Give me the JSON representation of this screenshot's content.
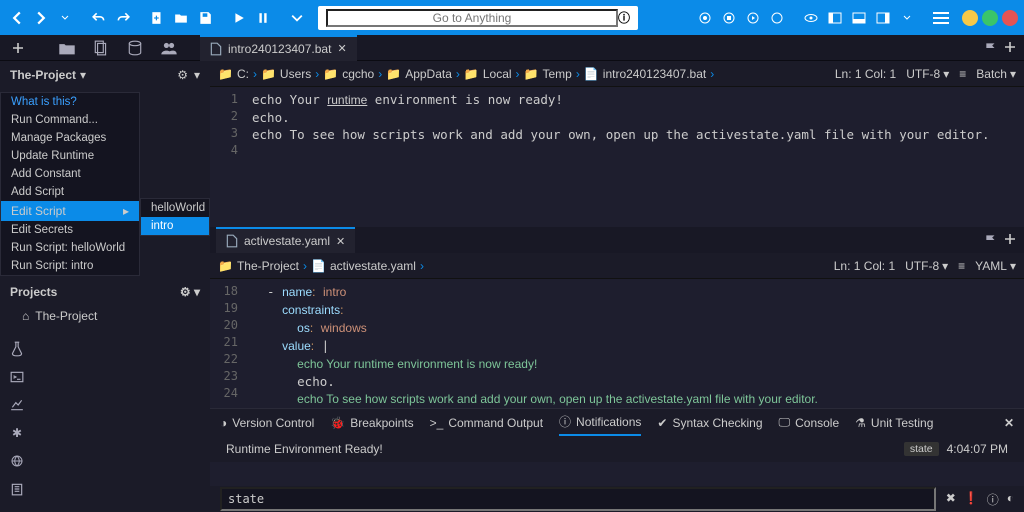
{
  "search": {
    "placeholder": "Go to Anything"
  },
  "sidebar": {
    "project_dropdown": "The-Project",
    "projects_label": "Projects",
    "project_item": "The-Project"
  },
  "context_menu": {
    "items": [
      "What is this?",
      "Run Command...",
      "Manage Packages",
      "Update Runtime",
      "Add Constant",
      "Add Script",
      "Edit Script",
      "Edit Secrets",
      "Run Script: helloWorld",
      "Run Script: intro"
    ],
    "submenu": [
      "helloWorld",
      "intro"
    ]
  },
  "tab1": {
    "filename": "intro240123407.bat"
  },
  "breadcrumb1": {
    "segs": [
      "C:",
      "Users",
      "cgcho",
      "AppData",
      "Local",
      "Temp",
      "intro240123407.bat"
    ],
    "status": "Ln: 1 Col: 1",
    "encoding": "UTF-8",
    "lang": "Batch"
  },
  "editor1": {
    "lines": [
      {
        "n": "1",
        "t": "echo Your runtime environment is now ready!"
      },
      {
        "n": "2",
        "t": "echo."
      },
      {
        "n": "3",
        "t": "echo To see how scripts work and add your own, open up the activestate.yaml file with your editor."
      },
      {
        "n": "4",
        "t": ""
      }
    ]
  },
  "tab2": {
    "filename": "activestate.yaml"
  },
  "breadcrumb2": {
    "segs": [
      "The-Project",
      "activestate.yaml"
    ],
    "status": "Ln: 1 Col: 1",
    "encoding": "UTF-8",
    "lang": "YAML"
  },
  "editor2": {
    "lines": [
      {
        "n": "18",
        "t": "  - name: intro"
      },
      {
        "n": "19",
        "t": "    constraints:"
      },
      {
        "n": "20",
        "t": "      os: windows"
      },
      {
        "n": "21",
        "t": "    value: |"
      },
      {
        "n": "22",
        "t": "      echo Your runtime environment is now ready!"
      },
      {
        "n": "23",
        "t": "      echo."
      },
      {
        "n": "24",
        "t": "      echo To see how scripts work and add your own, open up the activestate.yaml file with your editor."
      }
    ]
  },
  "bottom_tabs": [
    "Version Control",
    "Breakpoints",
    "Command Output",
    "Notifications",
    "Syntax Checking",
    "Console",
    "Unit Testing"
  ],
  "bottom_tabs_icons": [
    "vcs",
    "bug",
    "prompt",
    "info",
    "check",
    "screen",
    "flask"
  ],
  "notification": {
    "msg": "Runtime Environment Ready!",
    "badge": "state",
    "time": "4:04:07 PM"
  },
  "cmd_value": "state"
}
